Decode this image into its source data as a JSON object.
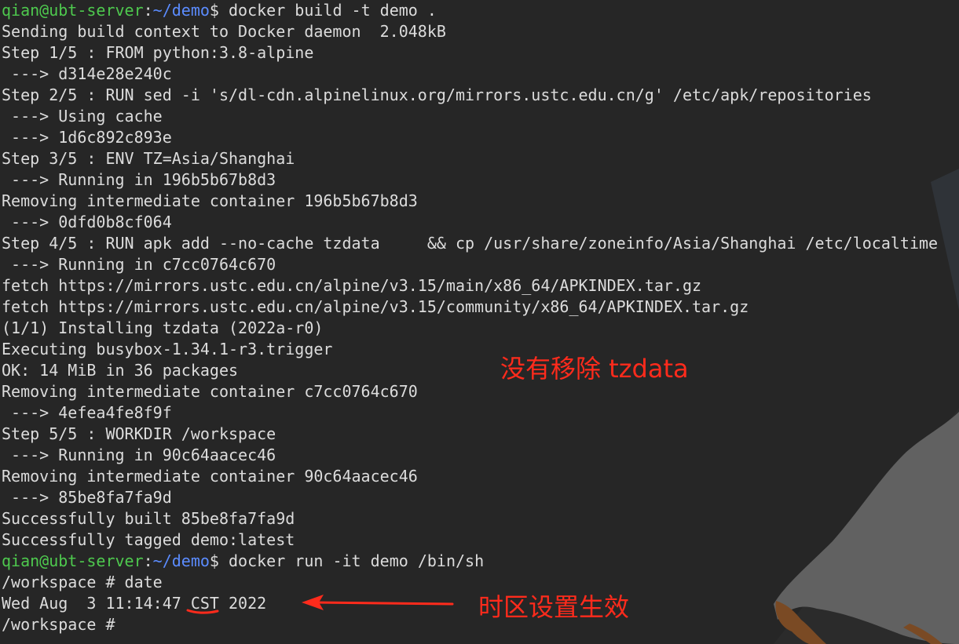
{
  "colors": {
    "background": "#262626",
    "text": "#dcdcdc",
    "prompt_user": "#4ec94e",
    "prompt_path": "#5b8cff",
    "annotation": "#ff2b1c"
  },
  "terminal": {
    "lines": [
      {
        "prompt": {
          "user": "qian@ubt-server",
          "sep": ":",
          "path": "~/demo",
          "symbol": "$"
        },
        "text": " docker build -t demo ."
      },
      {
        "text": "Sending build context to Docker daemon  2.048kB"
      },
      {
        "text": "Step 1/5 : FROM python:3.8-alpine"
      },
      {
        "text": " ---> d314e28e240c"
      },
      {
        "text": "Step 2/5 : RUN sed -i 's/dl-cdn.alpinelinux.org/mirrors.ustc.edu.cn/g' /etc/apk/repositories"
      },
      {
        "text": " ---> Using cache"
      },
      {
        "text": " ---> 1d6c892c893e"
      },
      {
        "text": "Step 3/5 : ENV TZ=Asia/Shanghai"
      },
      {
        "text": " ---> Running in 196b5b67b8d3"
      },
      {
        "text": "Removing intermediate container 196b5b67b8d3"
      },
      {
        "text": " ---> 0dfd0b8cf064"
      },
      {
        "text": "Step 4/5 : RUN apk add --no-cache tzdata     && cp /usr/share/zoneinfo/Asia/Shanghai /etc/localtime"
      },
      {
        "text": " ---> Running in c7cc0764c670"
      },
      {
        "text": "fetch https://mirrors.ustc.edu.cn/alpine/v3.15/main/x86_64/APKINDEX.tar.gz"
      },
      {
        "text": "fetch https://mirrors.ustc.edu.cn/alpine/v3.15/community/x86_64/APKINDEX.tar.gz"
      },
      {
        "text": "(1/1) Installing tzdata (2022a-r0)"
      },
      {
        "text": "Executing busybox-1.34.1-r3.trigger"
      },
      {
        "text": "OK: 14 MiB in 36 packages"
      },
      {
        "text": "Removing intermediate container c7cc0764c670"
      },
      {
        "text": " ---> 4efea4fe8f9f"
      },
      {
        "text": "Step 5/5 : WORKDIR /workspace"
      },
      {
        "text": " ---> Running in 90c64aacec46"
      },
      {
        "text": "Removing intermediate container 90c64aacec46"
      },
      {
        "text": " ---> 85be8fa7fa9d"
      },
      {
        "text": "Successfully built 85be8fa7fa9d"
      },
      {
        "text": "Successfully tagged demo:latest"
      },
      {
        "prompt": {
          "user": "qian@ubt-server",
          "sep": ":",
          "path": "~/demo",
          "symbol": "$"
        },
        "text": " docker run -it demo /bin/sh"
      },
      {
        "text": "/workspace # date"
      },
      {
        "text": "Wed Aug  3 11:14:47 CST 2022"
      },
      {
        "text": "/workspace # "
      }
    ]
  },
  "annotations": {
    "tzdata_note": "没有移除 tzdata",
    "timezone_note": "时区设置生效"
  }
}
